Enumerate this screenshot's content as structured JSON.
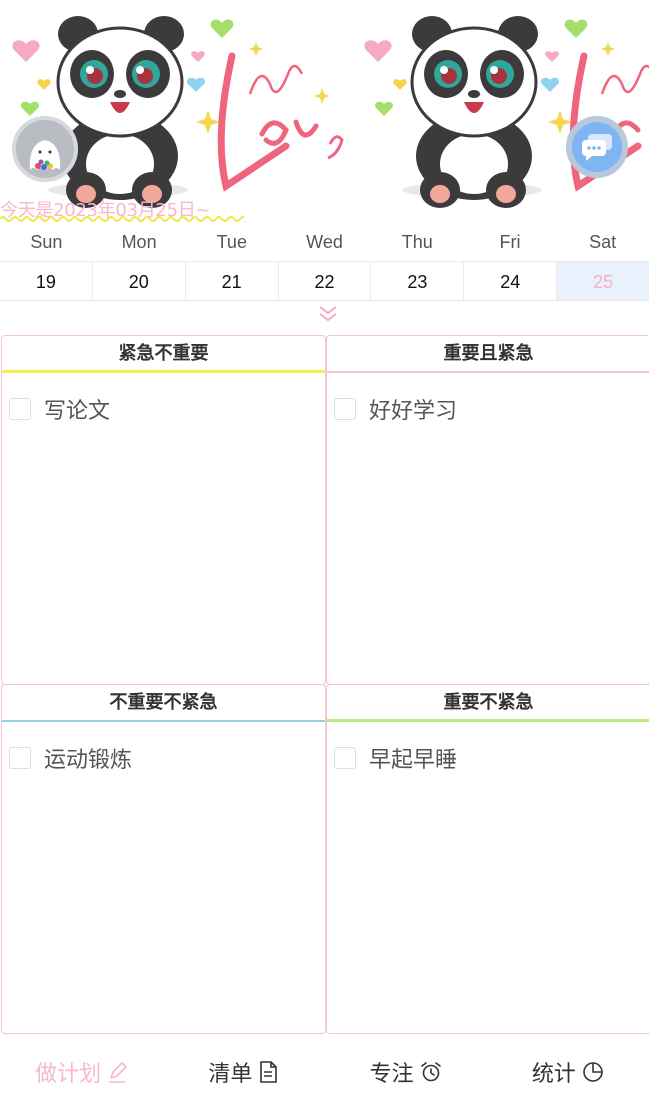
{
  "header": {
    "date_text": "今天是2023年03月25日~"
  },
  "icons": {
    "avatar": "ghost-avatar-icon",
    "chat": "chat-bubble-icon",
    "expand": "double-chevron-down-icon",
    "plan": "pencil-icon",
    "list": "document-icon",
    "focus": "alarm-clock-icon",
    "stats": "pie-chart-icon"
  },
  "colors": {
    "accent_pink": "#f7b8cc",
    "selected_day_bg": "#e9f1fd",
    "urgent_not_important": "#f4ef4a",
    "important_urgent": "#f5c6d3",
    "not_important_not_urgent": "#97cfe6",
    "important_not_urgent": "#b9ec7f"
  },
  "week": {
    "days": [
      "Sun",
      "Mon",
      "Tue",
      "Wed",
      "Thu",
      "Fri",
      "Sat"
    ],
    "dates": [
      "19",
      "20",
      "21",
      "22",
      "23",
      "24",
      "25"
    ],
    "selected_index": 6
  },
  "quadrants": {
    "q1": {
      "title": "紧急不重要",
      "tasks": [
        "写论文"
      ]
    },
    "q2": {
      "title": "重要且紧急",
      "tasks": [
        "好好学习"
      ]
    },
    "q3": {
      "title": "不重要不紧急",
      "tasks": [
        "运动锻炼"
      ]
    },
    "q4": {
      "title": "重要不紧急",
      "tasks": [
        "早起早睡"
      ]
    }
  },
  "tabbar": {
    "plan": "做计划",
    "list": "清单",
    "focus": "专注",
    "stats": "统计",
    "active": "plan"
  }
}
